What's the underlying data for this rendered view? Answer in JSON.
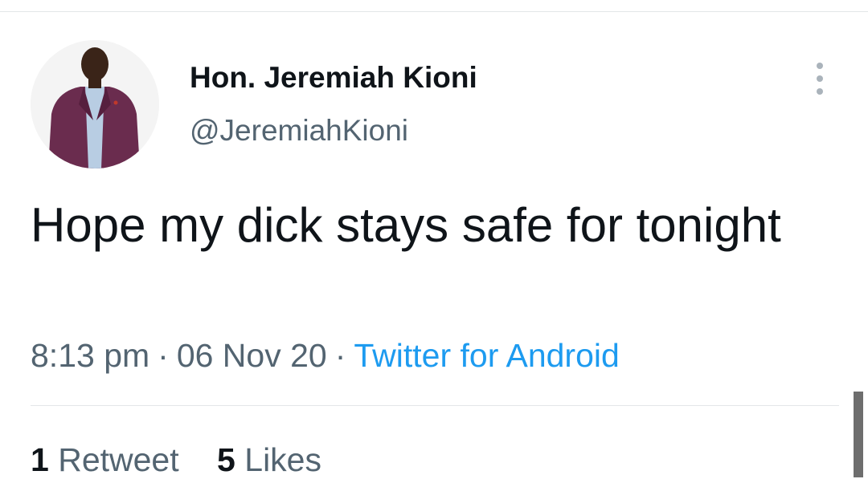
{
  "author": {
    "display_name": "Hon. Jeremiah Kioni",
    "handle": "@JeremiahKioni",
    "avatar_icon": "profile-photo"
  },
  "tweet": {
    "text": "Hope my dick stays safe for tonight",
    "time": "8:13 pm",
    "date": "06 Nov 20",
    "separator": "·",
    "source": "Twitter for Android"
  },
  "stats": {
    "retweets_count": "1",
    "retweets_label": "Retweet",
    "likes_count": "5",
    "likes_label": "Likes"
  },
  "colors": {
    "text_primary": "#0f1419",
    "text_secondary": "#536471",
    "link": "#1d9bf0",
    "divider": "#e3e6e8"
  },
  "icons": {
    "more": "more-vertical-icon"
  }
}
